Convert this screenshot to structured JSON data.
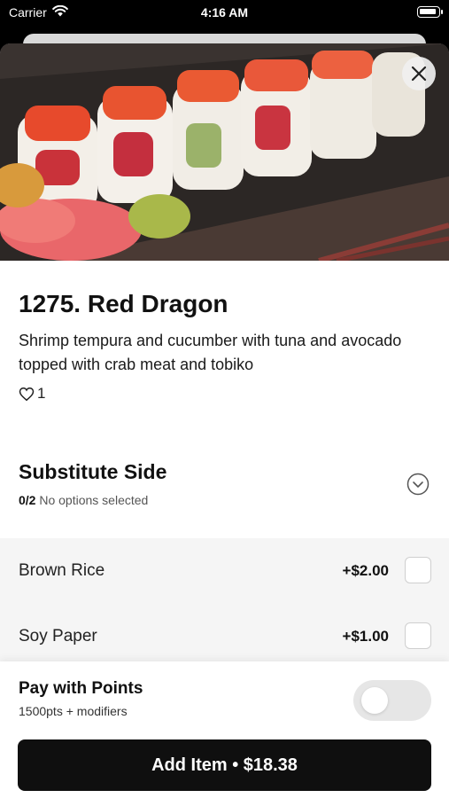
{
  "status_bar": {
    "carrier": "Carrier",
    "time": "4:16 AM"
  },
  "item": {
    "title": "1275. Red Dragon",
    "description": "Shrimp tempura and cucumber with tuna and avocado topped with crab meat and tobiko",
    "likes": "1"
  },
  "section": {
    "title": "Substitute Side",
    "count": "0/2",
    "status": "No options selected"
  },
  "options": [
    {
      "name": "Brown Rice",
      "price": "+$2.00",
      "checked": false
    },
    {
      "name": "Soy Paper",
      "price": "+$1.00",
      "checked": false
    }
  ],
  "points": {
    "title": "Pay with Points",
    "subtitle": "1500pts + modifiers",
    "enabled": false
  },
  "add_button": {
    "label": "Add Item • $18.38"
  },
  "icons": {
    "close": "close-icon",
    "heart": "heart-icon",
    "chevron": "chevron-down-circle-icon",
    "wifi": "wifi-icon",
    "battery": "battery-icon"
  },
  "colors": {
    "primary_button": "#0f0f0f",
    "options_bg": "#f5f5f5",
    "toggle_off": "#e6e6e6"
  }
}
